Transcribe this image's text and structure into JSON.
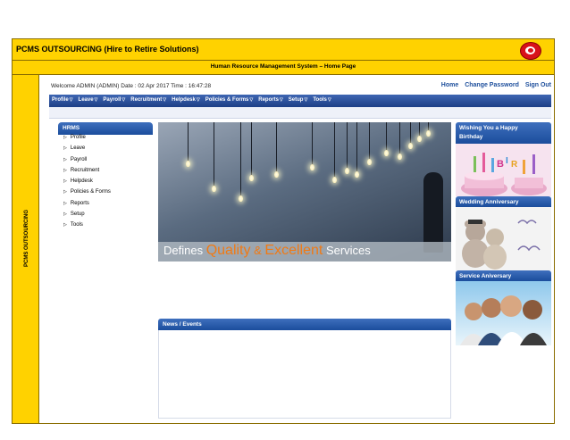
{
  "header": {
    "title": "PCMS OUTSOURCING (Hire to Retire Solutions)",
    "subtitle": "Human Resource Management System – Home Page",
    "side_label": "PCMS OUTSOURCING",
    "logo_icon": "pcms-logo-icon"
  },
  "app": {
    "welcome": "Welcome ADMIN (ADMIN)   Date : 02 Apr 2017   Time : 16:47:28",
    "links": {
      "home": "Home",
      "change_password": "Change Password",
      "sign_out": "Sign Out"
    },
    "menu": [
      {
        "label": "Profile"
      },
      {
        "label": "Leave"
      },
      {
        "label": "Payroll"
      },
      {
        "label": "Recruitment"
      },
      {
        "label": "Helpdesk"
      },
      {
        "label": "Policies & Forms"
      },
      {
        "label": "Reports"
      },
      {
        "label": "Setup"
      },
      {
        "label": "Tools"
      }
    ],
    "menu_arrow": "▽",
    "hrms": {
      "title": "HRMS",
      "items": [
        {
          "label": "Profile"
        },
        {
          "label": "Leave"
        },
        {
          "label": "Payroll"
        },
        {
          "label": "Recruitment"
        },
        {
          "label": "Helpdesk"
        },
        {
          "label": "Policies & Forms"
        },
        {
          "label": "Reports"
        },
        {
          "label": "Setup"
        },
        {
          "label": "Tools"
        }
      ]
    },
    "banner": {
      "word1": "Defines ",
      "word2": "Quality",
      "word3": " & ",
      "word4": "Excellent",
      "word5": " Services"
    },
    "news_title": "News / Events",
    "right": {
      "birthday_line1": "Wishing You a Happy",
      "birthday_line2": "Birthday",
      "anniversary": "Wedding Anniversary",
      "service": "Service Aniversary"
    }
  },
  "colors": {
    "header_yellow": "#ffd200",
    "menu_blue": "#1d3f86",
    "link_blue": "#1e4f9c",
    "logo_red": "#d8121b"
  }
}
